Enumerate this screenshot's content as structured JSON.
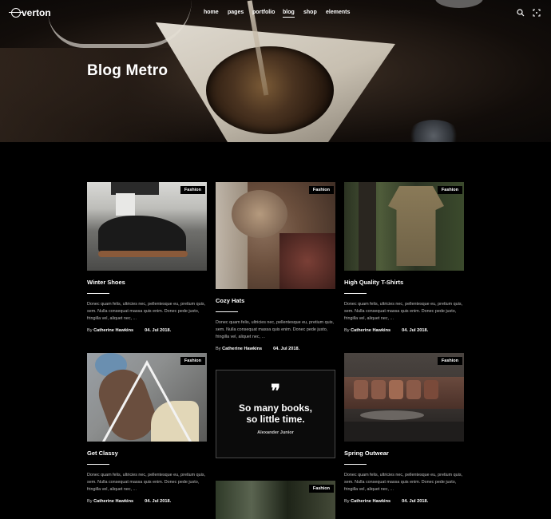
{
  "header": {
    "logo": "verton",
    "nav": [
      {
        "label": "home"
      },
      {
        "label": "pages"
      },
      {
        "label": "portfolio"
      },
      {
        "label": "blog"
      },
      {
        "label": "shop"
      },
      {
        "label": "elements"
      }
    ],
    "active_nav": "blog",
    "icons": [
      "search-icon",
      "expand-icon"
    ]
  },
  "hero": {
    "title": "Blog Metro"
  },
  "posts": [
    {
      "category": "Fashion",
      "title": "Winter Shoes",
      "excerpt": "Donec quam felis, ultricies nec, pellentesque eu, pretium quis, sem. Nulla consequat massa quis enim. Donec pede justo, fringilla vel, aliquet nec, ...",
      "author": "Catherine Hawkins",
      "by": "By",
      "date": "04. Jul 2018."
    },
    {
      "category": "Fashion",
      "title": "Cozy Hats",
      "excerpt": "Donec quam felis, ultricies nec, pellentesque eu, pretium quis, sem. Nulla consequat massa quis enim. Donec pede justo, fringilla vel, aliquet nec, ...",
      "author": "Catherine Hawkins",
      "by": "By",
      "date": "04. Jul 2018."
    },
    {
      "category": "Fashion",
      "title": "High Quality T-Shirts",
      "excerpt": "Donec quam felis, ultricies nec, pellentesque eu, pretium quis, sem. Nulla consequat massa quis enim. Donec pede justo, fringilla vel, aliquet nec, ...",
      "author": "Catherine Hawkins",
      "by": "By",
      "date": "04. Jul 2018."
    },
    {
      "category": "Fashion",
      "title": "Get Classy",
      "excerpt": "Donec quam felis, ultricies nec, pellentesque eu, pretium quis, sem. Nulla consequat massa quis enim. Donec pede justo, fringilla vel, aliquet nec, ...",
      "author": "Catherine Hawkins",
      "by": "By",
      "date": "04. Jul 2018."
    },
    {
      "category": "Fashion",
      "title": "Spring Outwear",
      "excerpt": "Donec quam felis, ultricies nec, pellentesque eu, pretium quis, sem. Nulla consequat massa quis enim. Donec pede justo, fringilla vel, aliquet nec, ...",
      "author": "Catherine Hawkins",
      "by": "By",
      "date": "04. Jul 2018."
    },
    {
      "category": "Fashion"
    }
  ],
  "quote": {
    "mark": "❞",
    "text_line1": "So many books,",
    "text_line2": "so little time.",
    "author": "Alexander Junior"
  },
  "colors": {
    "background": "#000000",
    "text": "#ffffff",
    "excerpt": "#bfbfbf"
  }
}
